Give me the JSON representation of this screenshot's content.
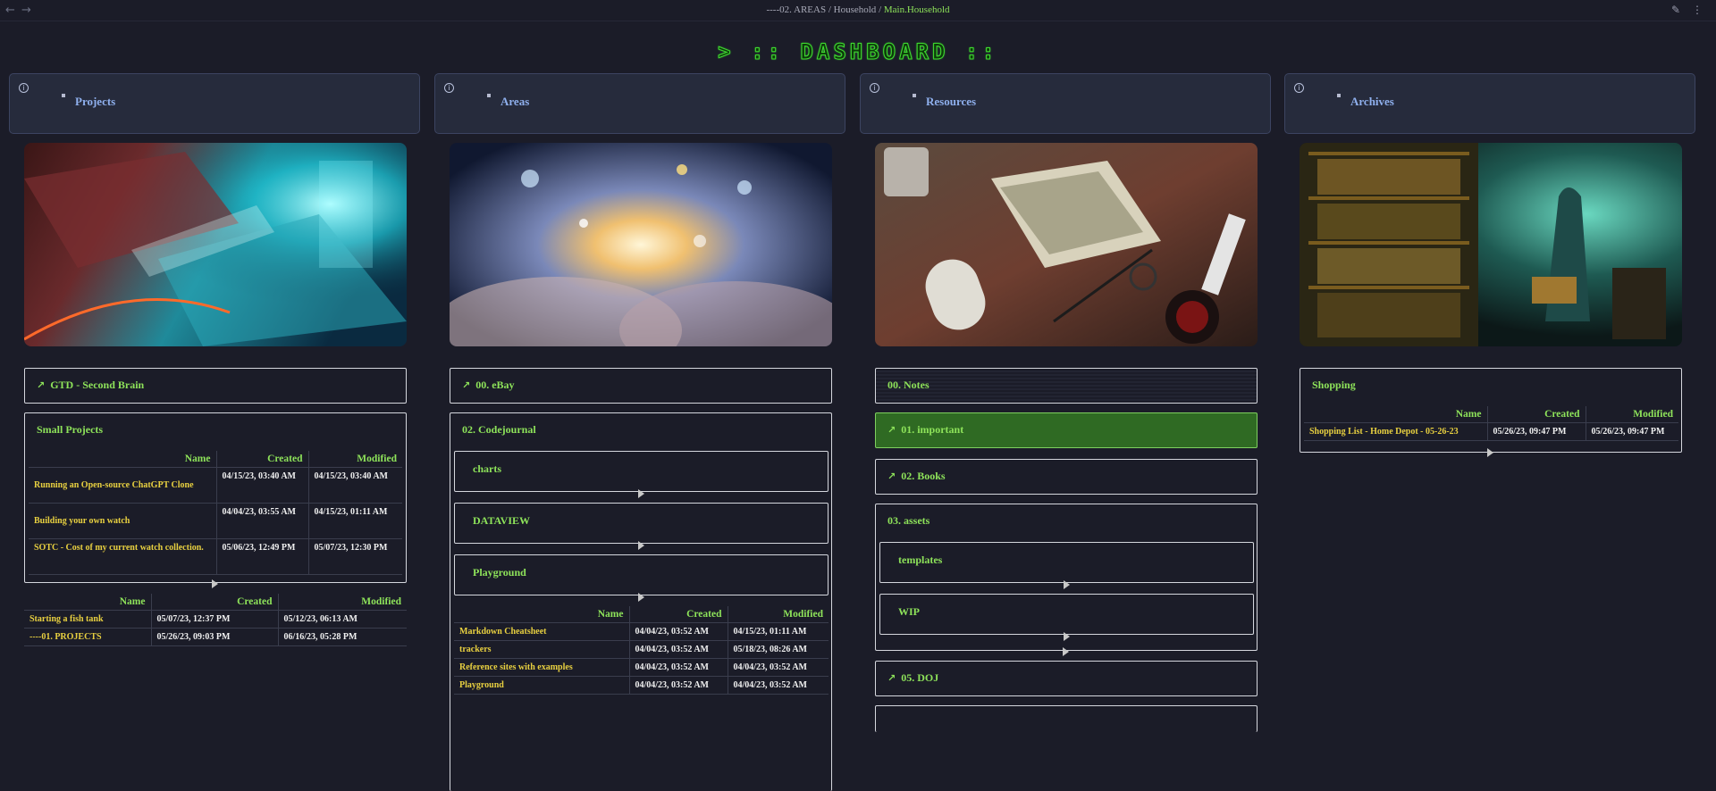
{
  "topbar": {
    "back": "←",
    "forward": "→",
    "crumb1": "----02. AREAS",
    "sep": " / ",
    "crumb2": "Household",
    "crumb3": "Main.Household",
    "edit_icon": "✎",
    "more_icon": "⋮"
  },
  "title": "> :: DASHBOARD ::",
  "columns": [
    {
      "callout": "Projects"
    },
    {
      "callout": "Areas"
    },
    {
      "callout": "Resources"
    },
    {
      "callout": "Archives"
    }
  ],
  "projects": {
    "gtd": "GTD - Second Brain",
    "small_title": "Small Projects",
    "headers": [
      "Name",
      "Created",
      "Modified"
    ],
    "small_rows": [
      [
        "Running an Open-source ChatGPT Clone",
        "04/15/23, 03:40 AM",
        "04/15/23, 03:40 AM"
      ],
      [
        "Building your own watch",
        "04/04/23, 03:55 AM",
        "04/15/23, 01:11 AM"
      ],
      [
        "SOTC - Cost of my current watch collection.",
        "05/06/23, 12:49 PM",
        "05/07/23, 12:30 PM"
      ]
    ],
    "rows": [
      [
        "Starting a fish tank",
        "05/07/23, 12:37 PM",
        "05/12/23, 06:13 AM"
      ],
      [
        "----01. PROJECTS",
        "05/26/23, 09:03 PM",
        "06/16/23, 05:28 PM"
      ]
    ]
  },
  "areas": {
    "ebay": "00. eBay",
    "codejournal": "02. Codejournal",
    "subs": [
      "charts",
      "DATAVIEW",
      "Playground"
    ],
    "headers": [
      "Name",
      "Created",
      "Modified"
    ],
    "rows": [
      [
        "Markdown Cheatsheet",
        "04/04/23, 03:52 AM",
        "04/15/23, 01:11 AM"
      ],
      [
        "trackers",
        "04/04/23, 03:52 AM",
        "05/18/23, 08:26 AM"
      ],
      [
        "Reference sites with examples",
        "04/04/23, 03:52 AM",
        "04/04/23, 03:52 AM"
      ],
      [
        "Playground",
        "04/04/23, 03:52 AM",
        "04/04/23, 03:52 AM"
      ]
    ]
  },
  "resources": {
    "notes": "00. Notes",
    "important": "01. important",
    "books": "02. Books",
    "assets": "03. assets",
    "subs": [
      "templates",
      "WIP"
    ],
    "doj": "05. DOJ"
  },
  "archives": {
    "shopping": "Shopping",
    "headers": [
      "Name",
      "Created",
      "Modified"
    ],
    "rows": [
      [
        "Shopping List - Home Depot - 05-26-23",
        "05/26/23, 09:47 PM",
        "05/26/23, 09:47 PM"
      ]
    ]
  },
  "icons": {
    "arrow": "↗",
    "info": "i"
  },
  "colors": {
    "accent": "#8ee35a",
    "link": "#8fb0ee",
    "name": "#e8d040",
    "highlight": "#2f6a23"
  }
}
